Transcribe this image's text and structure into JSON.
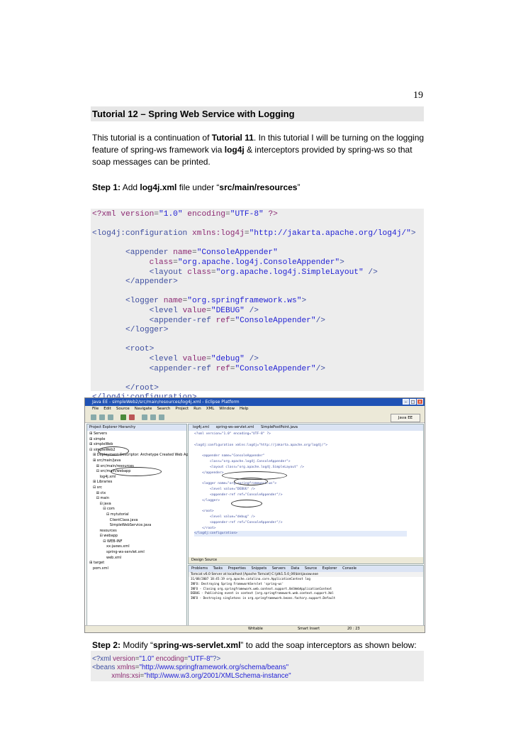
{
  "page_number": "19",
  "title": "Tutorial 12 – Spring Web Service with Logging",
  "intro": {
    "p1": "This tutorial is a continuation of ",
    "b1": "Tutorial 11",
    "p2": ". In this tutorial I will be turning on the logging feature of spring-ws framework via ",
    "b2": "log4j",
    "p3": " & interceptors provided by spring-ws so that soap messages can be printed."
  },
  "step1": {
    "label": "Step 1:",
    "t1": " Add ",
    "file": "log4j.xml",
    "t2": " file under “",
    "path": "src/main/resources",
    "t3": "”"
  },
  "log4j_code": [
    {
      "indent": "",
      "parts": [
        {
          "c": "kw",
          "t": "<?xml "
        },
        {
          "c": "at",
          "t": "version"
        },
        {
          "c": "pl",
          "t": "="
        },
        {
          "c": "st",
          "t": "\"1.0\""
        },
        {
          "c": "at",
          "t": " encoding"
        },
        {
          "c": "pl",
          "t": "="
        },
        {
          "c": "st",
          "t": "\"UTF-8\""
        },
        {
          "c": "kw",
          "t": " ?>"
        }
      ]
    },
    {
      "indent": "",
      "parts": []
    },
    {
      "indent": "",
      "parts": [
        {
          "c": "tg",
          "t": "<log4j:configuration "
        },
        {
          "c": "at",
          "t": "xmlns:log4j"
        },
        {
          "c": "pl",
          "t": "="
        },
        {
          "c": "st",
          "t": "\"http://jakarta.apache.org/log4j/\""
        },
        {
          "c": "tg",
          "t": ">"
        }
      ]
    },
    {
      "indent": "",
      "parts": []
    },
    {
      "indent": "       ",
      "parts": [
        {
          "c": "tg",
          "t": "<appender "
        },
        {
          "c": "at",
          "t": "name"
        },
        {
          "c": "pl",
          "t": "="
        },
        {
          "c": "st",
          "t": "\"ConsoleAppender\""
        }
      ]
    },
    {
      "indent": "            ",
      "parts": [
        {
          "c": "at",
          "t": "class"
        },
        {
          "c": "pl",
          "t": "="
        },
        {
          "c": "st",
          "t": "\"org.apache.log4j.ConsoleAppender\""
        },
        {
          "c": "tg",
          "t": ">"
        }
      ]
    },
    {
      "indent": "            ",
      "parts": [
        {
          "c": "tg",
          "t": "<layout "
        },
        {
          "c": "at",
          "t": "class"
        },
        {
          "c": "pl",
          "t": "="
        },
        {
          "c": "st",
          "t": "\"org.apache.log4j.SimpleLayout\""
        },
        {
          "c": "tg",
          "t": " />"
        }
      ]
    },
    {
      "indent": "       ",
      "parts": [
        {
          "c": "tg",
          "t": "</appender>"
        }
      ]
    },
    {
      "indent": "",
      "parts": []
    },
    {
      "indent": "       ",
      "parts": [
        {
          "c": "tg",
          "t": "<logger "
        },
        {
          "c": "at",
          "t": "name"
        },
        {
          "c": "pl",
          "t": "="
        },
        {
          "c": "st",
          "t": "\"org.springframework.ws\""
        },
        {
          "c": "tg",
          "t": ">"
        }
      ]
    },
    {
      "indent": "            ",
      "parts": [
        {
          "c": "tg",
          "t": "<level "
        },
        {
          "c": "at",
          "t": "value"
        },
        {
          "c": "pl",
          "t": "="
        },
        {
          "c": "st",
          "t": "\"DEBUG\""
        },
        {
          "c": "tg",
          "t": " />"
        }
      ]
    },
    {
      "indent": "            ",
      "parts": [
        {
          "c": "tg",
          "t": "<appender-ref "
        },
        {
          "c": "at",
          "t": "ref"
        },
        {
          "c": "pl",
          "t": "="
        },
        {
          "c": "st",
          "t": "\"ConsoleAppender\""
        },
        {
          "c": "tg",
          "t": "/>"
        }
      ]
    },
    {
      "indent": "       ",
      "parts": [
        {
          "c": "tg",
          "t": "</logger>"
        }
      ]
    },
    {
      "indent": "",
      "parts": []
    },
    {
      "indent": "       ",
      "parts": [
        {
          "c": "tg",
          "t": "<root>"
        }
      ]
    },
    {
      "indent": "            ",
      "parts": [
        {
          "c": "tg",
          "t": "<level "
        },
        {
          "c": "at",
          "t": "value"
        },
        {
          "c": "pl",
          "t": "="
        },
        {
          "c": "st",
          "t": "\"debug\""
        },
        {
          "c": "tg",
          "t": " />"
        }
      ]
    },
    {
      "indent": "            ",
      "parts": [
        {
          "c": "tg",
          "t": "<appender-ref "
        },
        {
          "c": "at",
          "t": "ref"
        },
        {
          "c": "pl",
          "t": "="
        },
        {
          "c": "st",
          "t": "\"ConsoleAppender\""
        },
        {
          "c": "tg",
          "t": "/>"
        }
      ]
    },
    {
      "indent": "",
      "parts": []
    },
    {
      "indent": "       ",
      "parts": [
        {
          "c": "tg",
          "t": "</root>"
        }
      ]
    },
    {
      "indent": "",
      "parts": [
        {
          "c": "tg",
          "t": "</log4j:configuration>"
        }
      ]
    }
  ],
  "screenshot": {
    "window_title": "Java EE - simpleWeb2/src/main/resources/log4j.xml - Eclipse Platform",
    "menu": [
      "File",
      "Edit",
      "Source",
      "Navigate",
      "Search",
      "Project",
      "Run",
      "XML",
      "Window",
      "Help"
    ],
    "perspective": "Java EE",
    "left_tabs": "Project Explorer   Hierarchy",
    "tree": [
      "  ⊞ Servers",
      "  ⊞ simple",
      "  ⊞ simpleWeb",
      "  ⊟ simpleWeb2",
      "     ⊞ Deployment Descriptor: Archetype Created Web Application",
      "     ⊞ src/main/java",
      "        ⊞ src/main/resources",
      "        ⊟ src/main/webapp",
      "           log4j.xml",
      "     ⊞ Libraries",
      "     ⊟ src",
      "        ⊞ ctx",
      "        ⊟ main",
      "           ⊟ java",
      "              ⊟ com",
      "                 ⊟ mytutorial",
      "                    ClientClass.java",
      "                    SimpleWebService.java",
      "           resources",
      "           ⊟ webapp",
      "              ⊟ WEB-INF",
      "                 xx-jaxws.xml",
      "                 spring-ws-servlet.xml",
      "                 web.xml",
      "  ⊞ target",
      "     pom.xml"
    ],
    "editor_tabs": "log4j.xml   spring-ws-servlet.xml   SimplePostPoint.java",
    "editor_lines": [
      "<?xml version=\"1.0\" encoding=\"UTF-8\" ?>",
      "",
      "<log4j:configuration xmlns:log4j=\"http://jakarta.apache.org/log4j/\">",
      "",
      "    <appender name=\"ConsoleAppender\"",
      "        class=\"org.apache.log4j.ConsoleAppender\">",
      "        <layout class=\"org.apache.log4j.SimpleLayout\" />",
      "    </appender>",
      "",
      "    <logger name=\"org.springframework.ws\">",
      "        <level value=\"DEBUG\" />",
      "        <appender-ref ref=\"ConsoleAppender\"/>",
      "    </logger>",
      "",
      "    <root>",
      "        <level value=\"debug\" />",
      "        <appender-ref ref=\"ConsoleAppender\"/>",
      "    </root>",
      "</log4j:configuration>"
    ],
    "editor_bottom_tabs": "Design  Source",
    "console_tabs": "Problems  Tasks  Properties  Snippets  Servers  Data Source Explorer  Console",
    "console_header": "Tomcat v6.0 Server at localhost [Apache Tomcat] C:\\jdk1.5.0_06\\bin\\javaw.exe",
    "console_lines": [
      "31/08/2007 18:45:19 org.apache.catalina.core.ApplicationContext log",
      "INFO: Destroying Spring FrameworkServlet 'spring-ws'",
      "INFO - Closing org.springframework.web.context.support.XmlWebApplicationContext",
      "DEBUG - Publishing event in context [org.springframework.web.context.support.Xml",
      "INFO - Destroying singletons in org.springframework.beans.factory.support.Default"
    ],
    "status_writable": "Writable",
    "status_insert": "Smart Insert",
    "status_pos": "20 : 23"
  },
  "step2": {
    "label": "Step 2:",
    "t1": " Modify “",
    "file": "spring-ws-servlet.xml",
    "t2": "” to add the soap interceptors as shown below:"
  },
  "servlet_code": {
    "l1a": "<?xml ",
    "l1b": "version",
    "l1c": "=",
    "l1d": "\"1.0\"",
    "l1e": " encoding",
    "l1f": "=",
    "l1g": "\"UTF-8\"",
    "l1h": "?>",
    "l2a": "<beans ",
    "l2b": "xmlns",
    "l2c": "=",
    "l2d": "\"http://www.springframework.org/schema/beans\"",
    "l3a": "          xmlns:xsi",
    "l3b": "=",
    "l3c": "\"http://www.w3.org/2001/XMLSchema-instance\""
  },
  "colors": {
    "keyword": "#8c2a72",
    "tag": "#3f4fa0",
    "string": "#1f1fd4",
    "titlebar_bg": "#e6e6e6",
    "code_bg": "#ededed",
    "eclipse_title": "#1f52b5"
  }
}
